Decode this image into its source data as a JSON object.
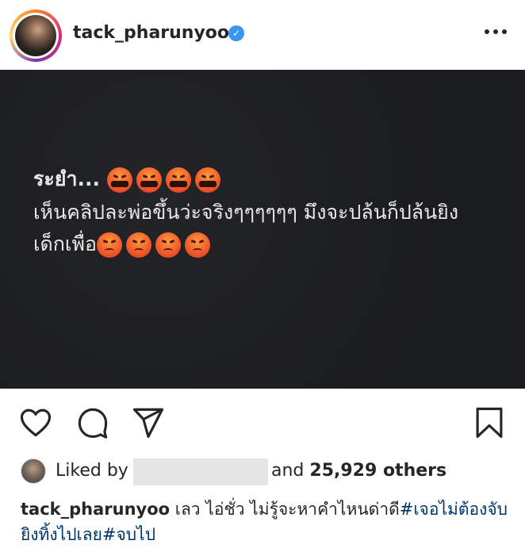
{
  "header": {
    "username": "tack_pharunyoo",
    "verified_icon": "verified-badge-icon",
    "more_icon": "more-options-icon"
  },
  "post": {
    "line1_text": "ระยำ...",
    "line1_emoji": "face-with-symbols-on-mouth",
    "line1_emoji_count": 4,
    "line2_text": "เห็นคลิปละพ่อขึ้นว่ะจริงๆๆๆๆๆๆ มึงจะปล้นก็ปล้นยิง",
    "line3_text": "เด็กเพื่อ",
    "line3_emoji": "pouting-face",
    "line3_emoji_count": 4,
    "background_color": "#1e1f21",
    "text_color": "#e8e8e8"
  },
  "actions": {
    "like_icon": "heart-icon",
    "comment_icon": "comment-icon",
    "share_icon": "share-icon",
    "save_icon": "bookmark-icon"
  },
  "likes": {
    "liked_by_label": "Liked by",
    "and_label": "and",
    "count": "25,929 others"
  },
  "caption": {
    "username": "tack_pharunyoo",
    "text": "เลว ไอ่ชั่ว ไม่รู้จะหาคำไหนด่าดี",
    "hashtag1": "#เจอไม่ต้องจับยิงทิ้งไปเลย",
    "hashtag2": "#จบไป",
    "hashtag_color": "#003569"
  }
}
